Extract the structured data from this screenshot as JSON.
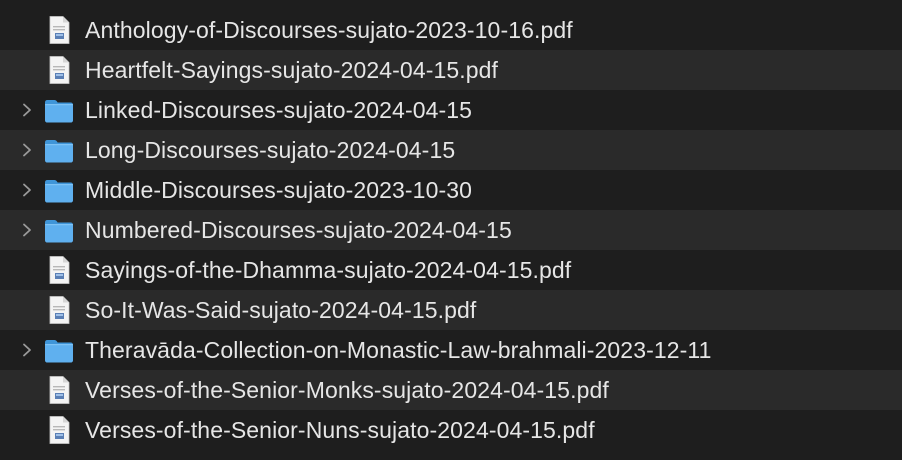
{
  "files": [
    {
      "name": "Anthology-of-Discourses-sujato-2023-10-16.pdf",
      "type": "pdf",
      "icon": "pdf-document-icon"
    },
    {
      "name": "Heartfelt-Sayings-sujato-2024-04-15.pdf",
      "type": "pdf",
      "icon": "pdf-document-icon"
    },
    {
      "name": "Linked-Discourses-sujato-2024-04-15",
      "type": "folder",
      "icon": "folder-icon"
    },
    {
      "name": "Long-Discourses-sujato-2024-04-15",
      "type": "folder",
      "icon": "folder-icon"
    },
    {
      "name": "Middle-Discourses-sujato-2023-10-30",
      "type": "folder",
      "icon": "folder-icon"
    },
    {
      "name": "Numbered-Discourses-sujato-2024-04-15",
      "type": "folder",
      "icon": "folder-icon"
    },
    {
      "name": "Sayings-of-the-Dhamma-sujato-2024-04-15.pdf",
      "type": "pdf",
      "icon": "pdf-document-icon"
    },
    {
      "name": "So-It-Was-Said-sujato-2024-04-15.pdf",
      "type": "pdf",
      "icon": "pdf-document-icon"
    },
    {
      "name": "Theravāda-Collection-on-Monastic-Law-brahmali-2023-12-11",
      "type": "folder",
      "icon": "folder-icon"
    },
    {
      "name": "Verses-of-the-Senior-Monks-sujato-2024-04-15.pdf",
      "type": "pdf",
      "icon": "pdf-document-icon"
    },
    {
      "name": "Verses-of-the-Senior-Nuns-sujato-2024-04-15.pdf",
      "type": "pdf",
      "icon": "pdf-document-icon"
    }
  ],
  "colors": {
    "background": "#1e1e1e",
    "row_alternate": "#2a2a2a",
    "text": "#e6e6e6",
    "folder": "#5fb0ef",
    "disclosure": "#9a9a9a"
  }
}
